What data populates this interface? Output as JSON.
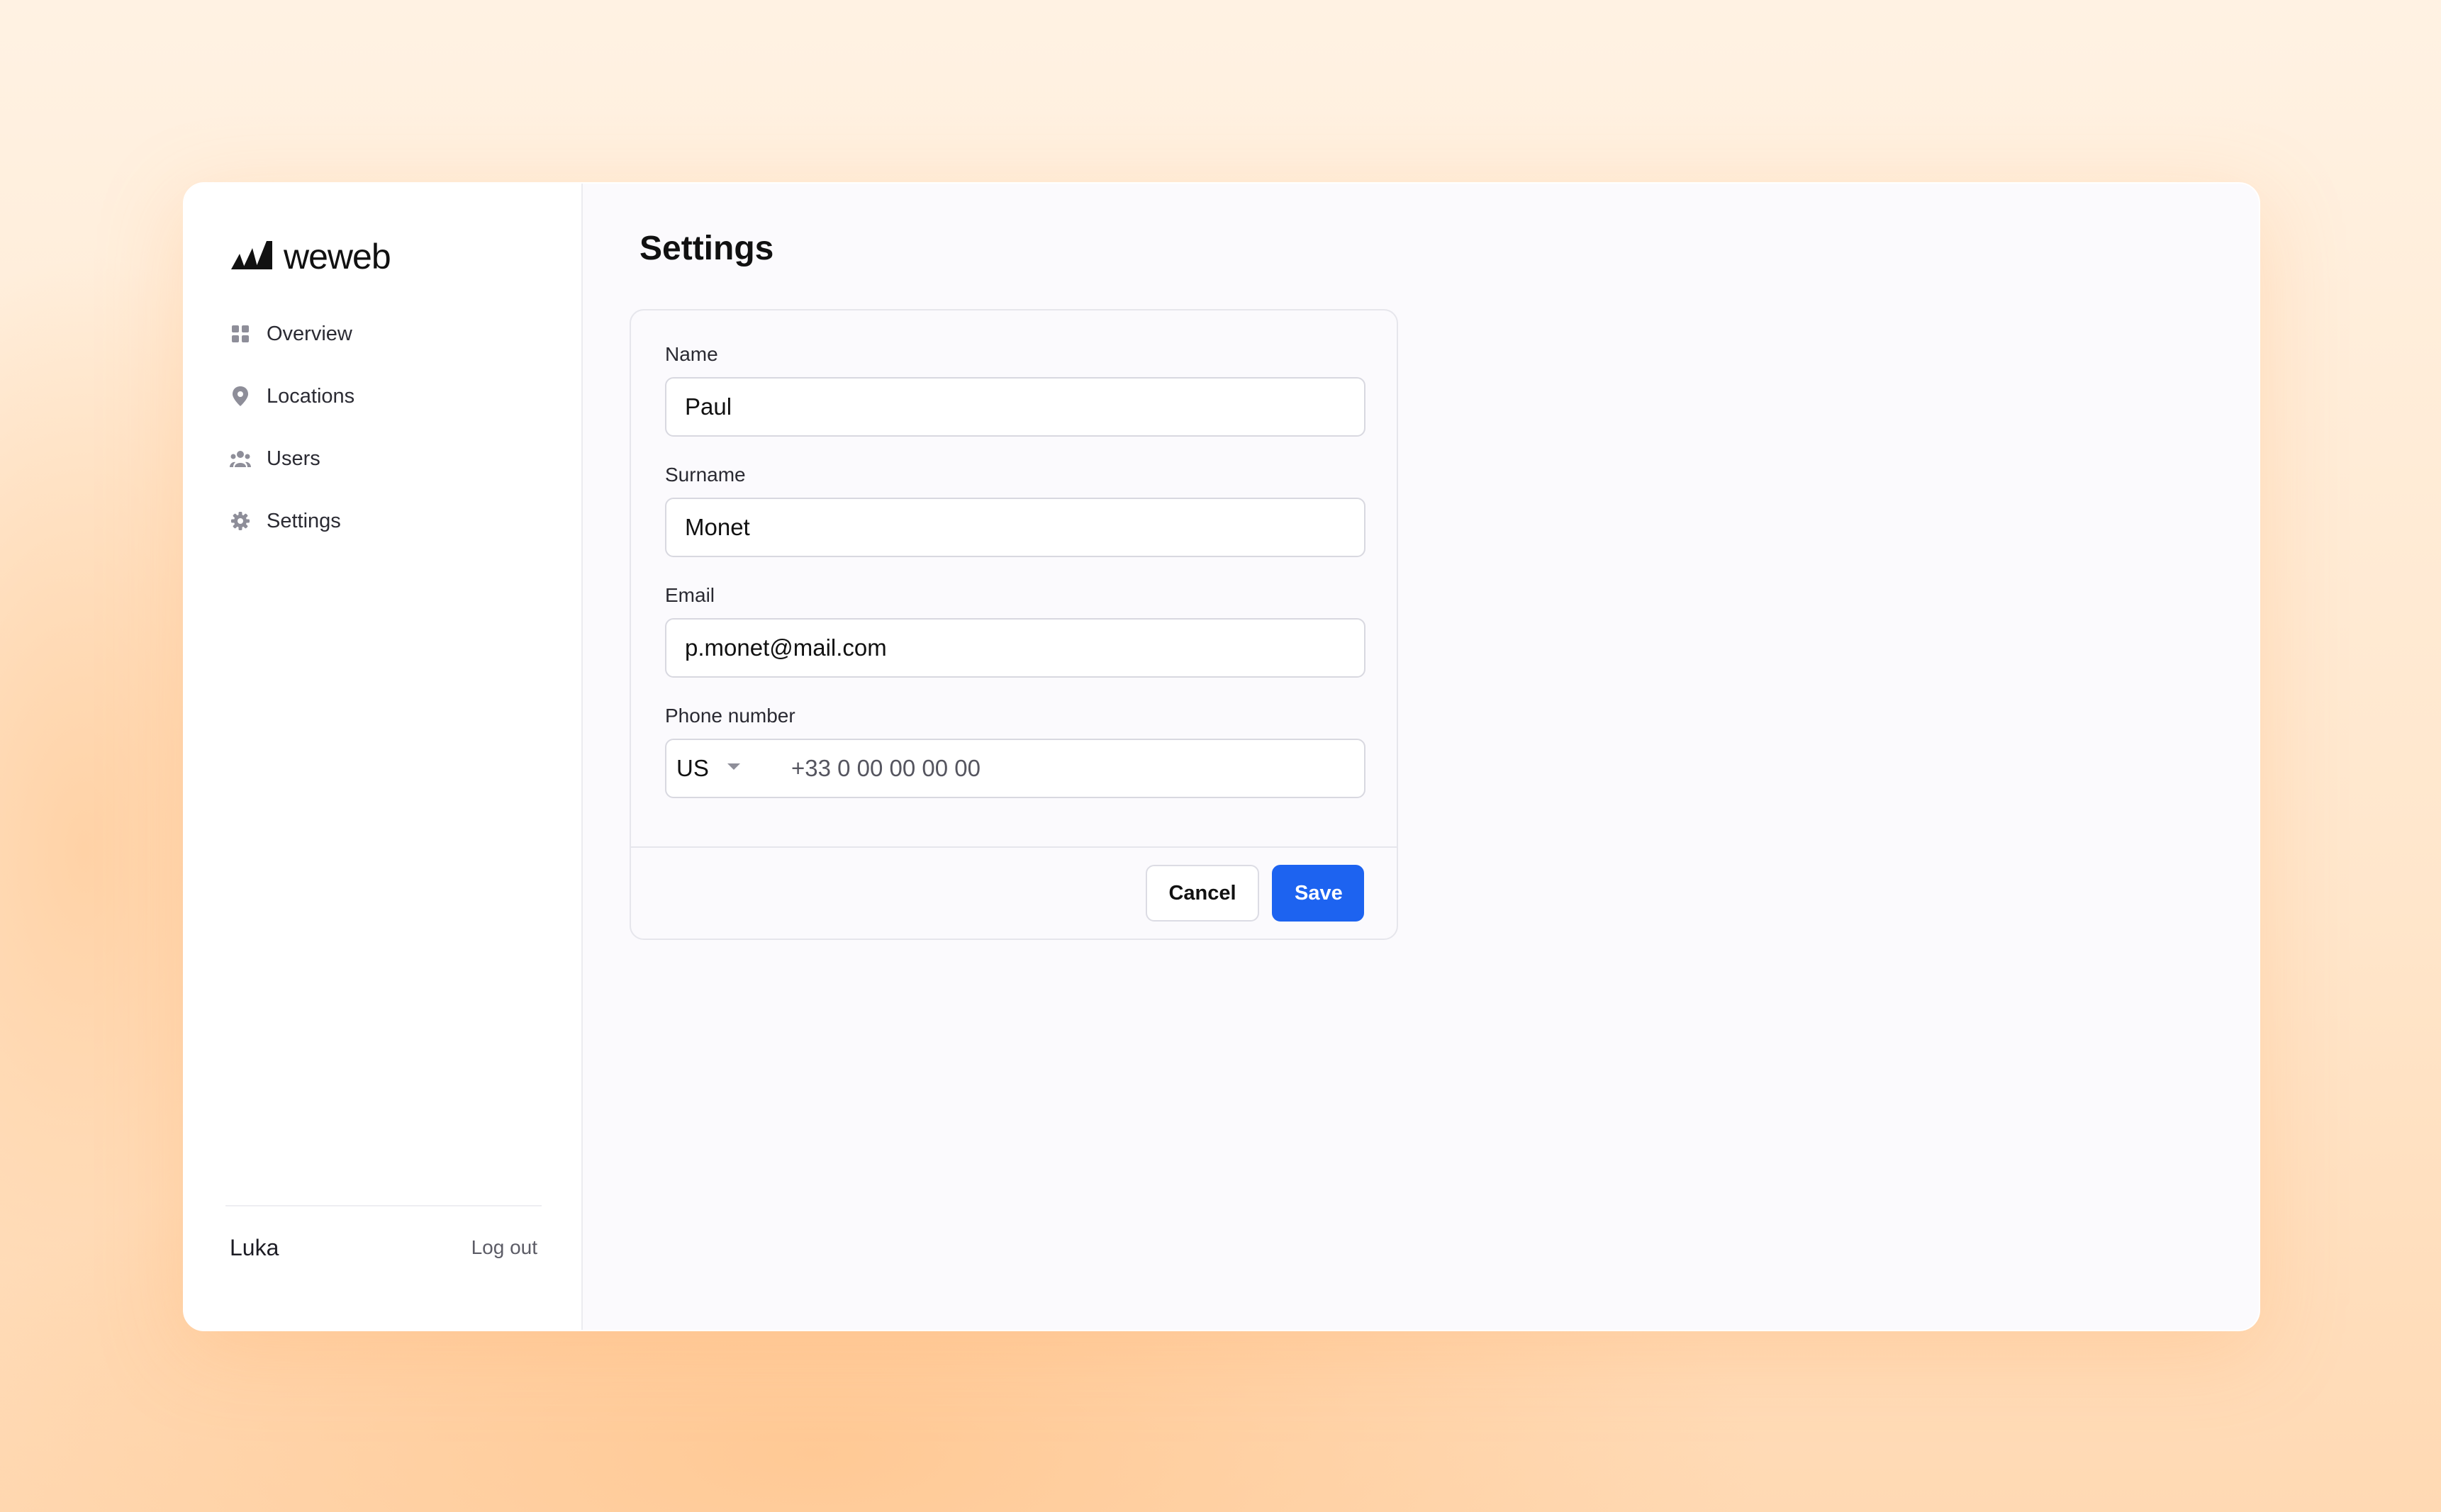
{
  "brand": {
    "name": "weweb"
  },
  "sidebar": {
    "items": [
      {
        "label": "Overview",
        "icon": "grid-icon"
      },
      {
        "label": "Locations",
        "icon": "map-pin-icon"
      },
      {
        "label": "Users",
        "icon": "users-icon"
      },
      {
        "label": "Settings",
        "icon": "gear-icon"
      }
    ],
    "user_name": "Luka",
    "logout_label": "Log out"
  },
  "main": {
    "title": "Settings",
    "form": {
      "name_label": "Name",
      "name_value": "Paul",
      "surname_label": "Surname",
      "surname_value": "Monet",
      "email_label": "Email",
      "email_value": "p.monet@mail.com",
      "phone_label": "Phone number",
      "phone_country": "US",
      "phone_placeholder": "+33 0 00 00 00 00",
      "cancel_label": "Cancel",
      "save_label": "Save"
    }
  },
  "colors": {
    "accent": "#1d63f0",
    "icon_gray": "#8e8e99"
  }
}
